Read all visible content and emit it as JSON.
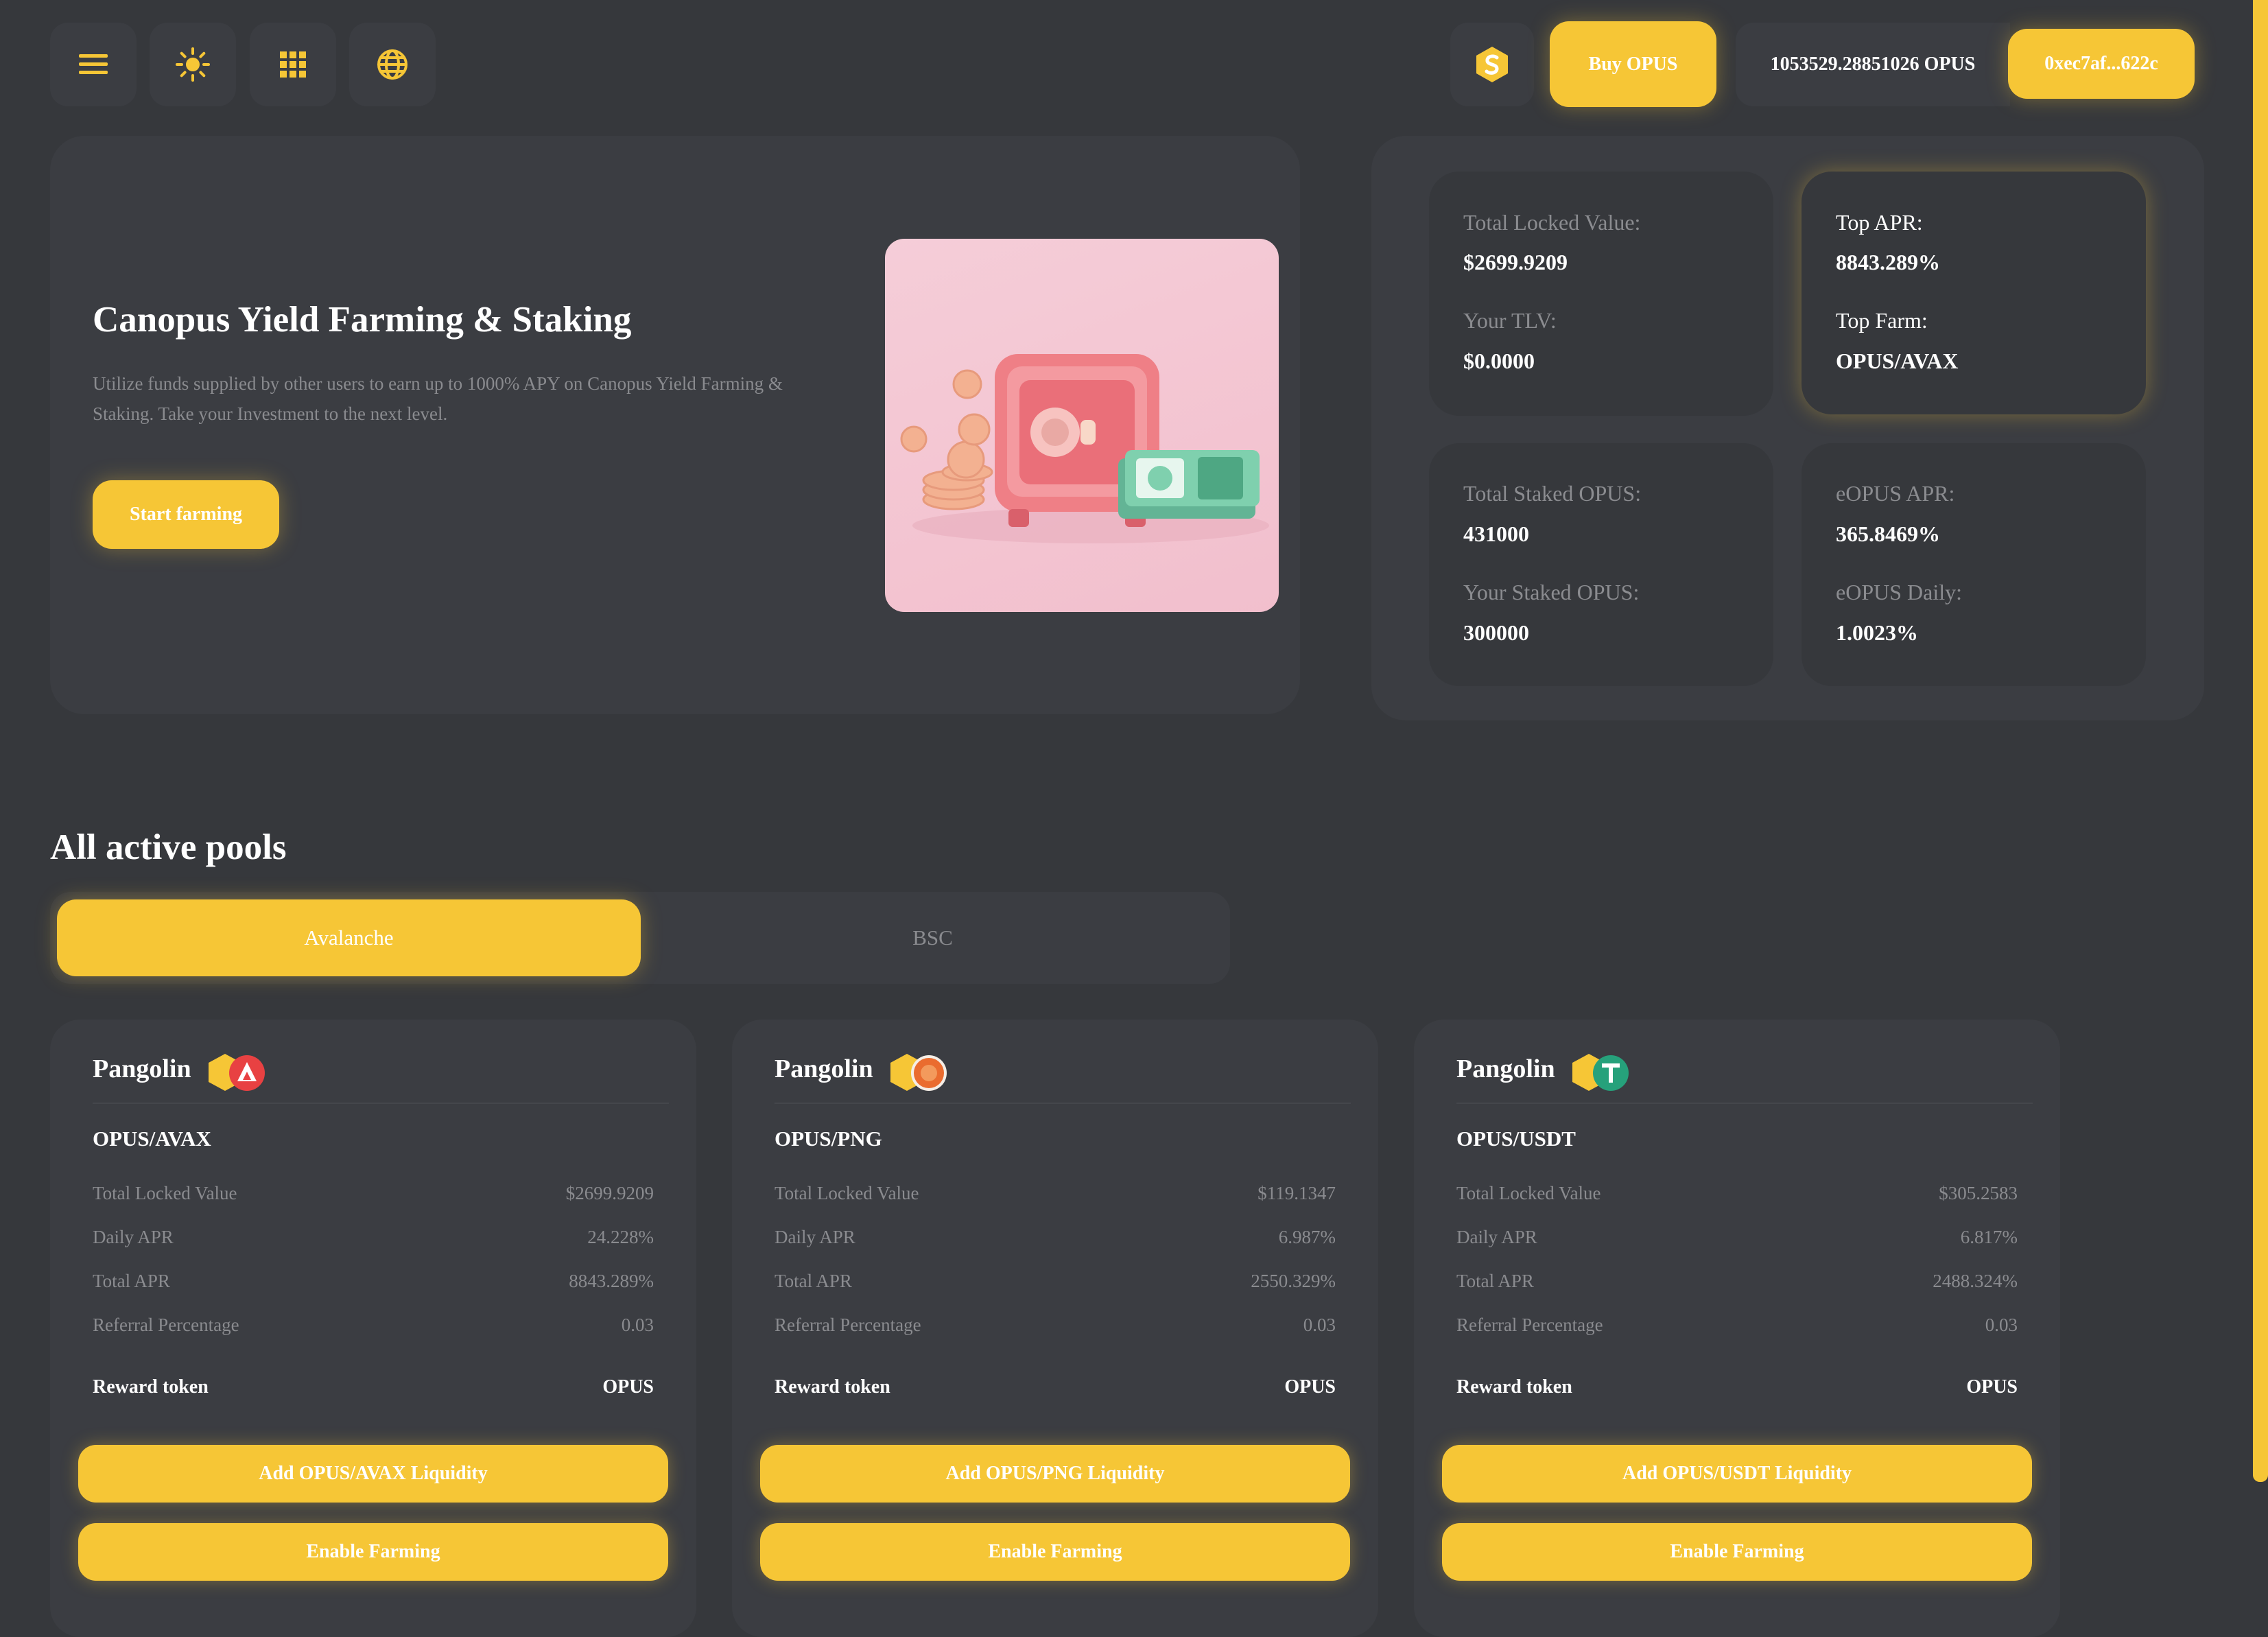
{
  "colors": {
    "accent": "#f6c636",
    "background": "#36383c",
    "card": "#3b3d42",
    "muted": "#8a8b8f"
  },
  "topbar": {
    "icons": [
      "menu-icon",
      "sun-icon",
      "grid-icon",
      "globe-icon"
    ],
    "buy_label": "Buy OPUS",
    "balance": "1053529.28851026 OPUS",
    "wallet": "0xec7af...622c"
  },
  "hero": {
    "title": "Canopus Yield Farming & Staking",
    "description": "Utilize funds supplied by other users to earn up to 1000% APY on Canopus Yield Farming & Staking. Take your Investment to the next level.",
    "cta": "Start farming"
  },
  "stats": {
    "total_locked_label": "Total Locked Value:",
    "total_locked_value": "$2699.9209",
    "your_tlv_label": "Your TLV:",
    "your_tlv_value": "$0.0000",
    "top_apr_label": "Top APR:",
    "top_apr_value": "8843.289%",
    "top_farm_label": "Top Farm:",
    "top_farm_value": "OPUS/AVAX",
    "total_staked_label": "Total Staked OPUS:",
    "total_staked_value": "431000",
    "your_staked_label": "Your Staked OPUS:",
    "your_staked_value": "300000",
    "eopus_apr_label": "eOPUS APR:",
    "eopus_apr_value": "365.8469%",
    "eopus_daily_label": "eOPUS Daily:",
    "eopus_daily_value": "1.0023%"
  },
  "pools_section": {
    "title": "All active pools",
    "tabs": [
      "Avalanche",
      "BSC"
    ]
  },
  "pools": [
    {
      "dex": "Pangolin",
      "pair": "OPUS/AVAX",
      "rows": [
        {
          "label": "Total Locked Value",
          "value": "$2699.9209"
        },
        {
          "label": "Daily APR",
          "value": "24.228%"
        },
        {
          "label": "Total APR",
          "value": "8843.289%"
        },
        {
          "label": "Referral Percentage",
          "value": "0.03"
        }
      ],
      "reward_label": "Reward token",
      "reward_value": "OPUS",
      "add_label": "Add OPUS/AVAX Liquidity",
      "enable_label": "Enable Farming"
    },
    {
      "dex": "Pangolin",
      "pair": "OPUS/PNG",
      "rows": [
        {
          "label": "Total Locked Value",
          "value": "$119.1347"
        },
        {
          "label": "Daily APR",
          "value": "6.987%"
        },
        {
          "label": "Total APR",
          "value": "2550.329%"
        },
        {
          "label": "Referral Percentage",
          "value": "0.03"
        }
      ],
      "reward_label": "Reward token",
      "reward_value": "OPUS",
      "add_label": "Add OPUS/PNG Liquidity",
      "enable_label": "Enable Farming"
    },
    {
      "dex": "Pangolin",
      "pair": "OPUS/USDT",
      "rows": [
        {
          "label": "Total Locked Value",
          "value": "$305.2583"
        },
        {
          "label": "Daily APR",
          "value": "6.817%"
        },
        {
          "label": "Total APR",
          "value": "2488.324%"
        },
        {
          "label": "Referral Percentage",
          "value": "0.03"
        }
      ],
      "reward_label": "Reward token",
      "reward_value": "OPUS",
      "add_label": "Add OPUS/USDT Liquidity",
      "enable_label": "Enable Farming"
    }
  ]
}
